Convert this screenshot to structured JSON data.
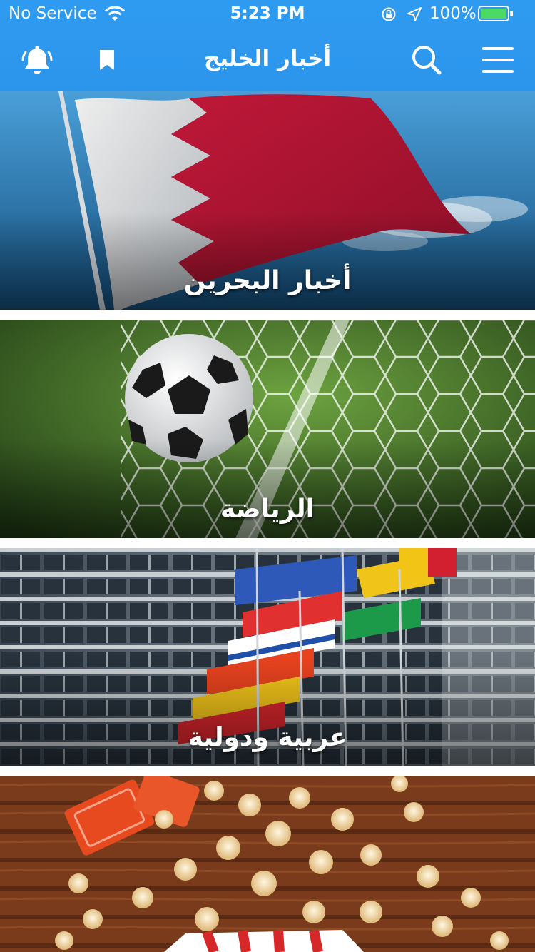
{
  "status_bar": {
    "carrier": "No Service",
    "time": "5:23 PM",
    "battery": "100%"
  },
  "header": {
    "title": "أخبار الخليج",
    "icons": {
      "notifications": "bell-icon",
      "bookmarks": "bookmark-icon",
      "search": "search-icon",
      "menu": "menu-icon"
    }
  },
  "colors": {
    "header_bg": "#2f9bf0",
    "battery_fill": "#4cd964",
    "text": "#ffffff"
  },
  "categories": [
    {
      "label": "أخبار البحرين",
      "image": "bahrain-flag"
    },
    {
      "label": "الرياضة",
      "image": "soccer-ball-in-net"
    },
    {
      "label": "عربية ودولية",
      "image": "flags-in-front-of-building"
    },
    {
      "label": "",
      "image": "popcorn-and-tickets"
    }
  ]
}
